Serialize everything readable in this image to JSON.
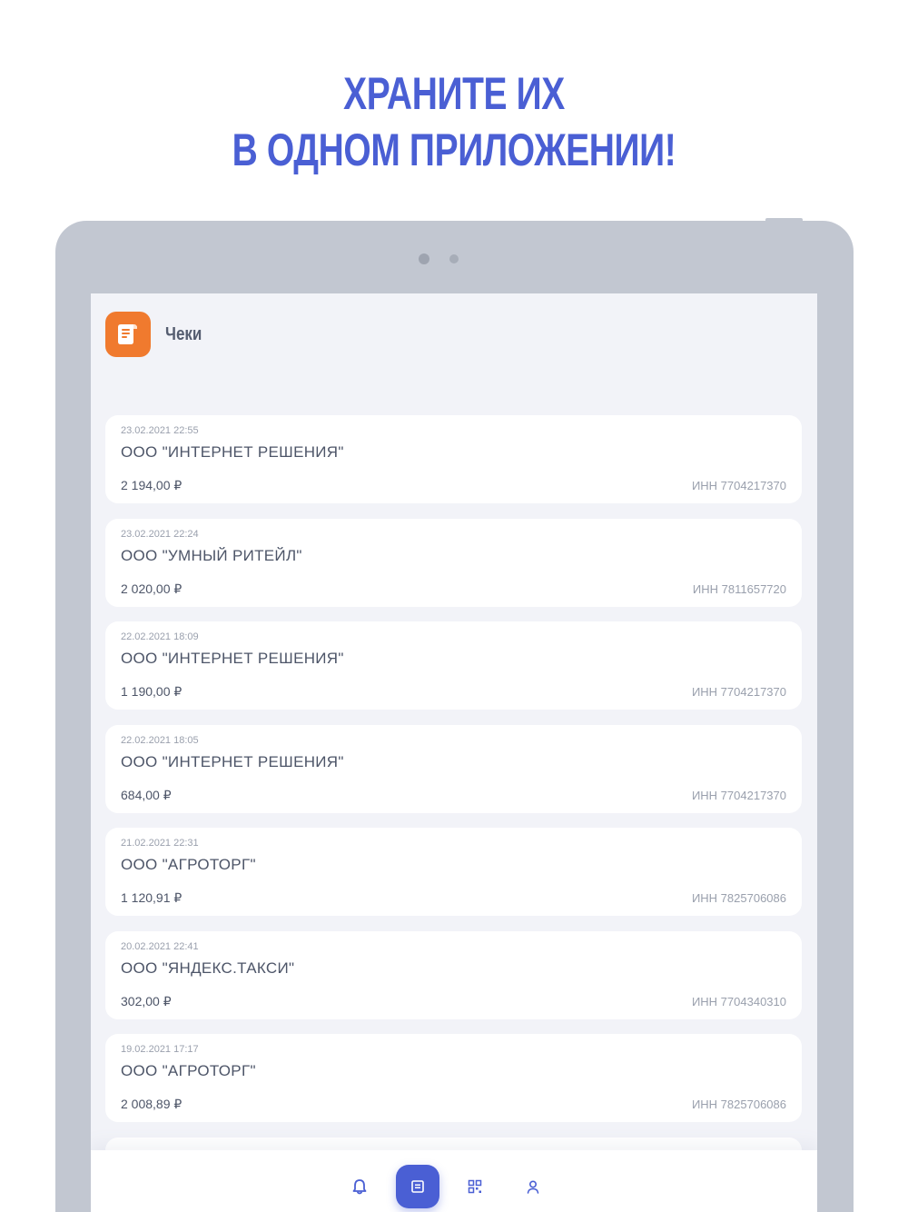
{
  "headline": {
    "line1": "ХРАНИТЕ ИХ",
    "line2": "В ОДНОМ ПРИЛОЖЕНИИ!"
  },
  "app": {
    "title": "Чеки",
    "icon": "receipt-scroll-icon"
  },
  "receipts": [
    {
      "date": "23.02.2021 22:55",
      "name": "ООО \"ИНТЕРНЕТ РЕШЕНИЯ\"",
      "amount": "2 194,00 ₽",
      "inn": "ИНН 7704217370"
    },
    {
      "date": "23.02.2021 22:24",
      "name": "ООО \"УМНЫЙ РИТЕЙЛ\"",
      "amount": "2 020,00 ₽",
      "inn": "ИНН 7811657720"
    },
    {
      "date": "22.02.2021 18:09",
      "name": "ООО \"ИНТЕРНЕТ РЕШЕНИЯ\"",
      "amount": "1 190,00 ₽",
      "inn": "ИНН 7704217370"
    },
    {
      "date": "22.02.2021 18:05",
      "name": "ООО \"ИНТЕРНЕТ РЕШЕНИЯ\"",
      "amount": "684,00 ₽",
      "inn": "ИНН 7704217370"
    },
    {
      "date": "21.02.2021 22:31",
      "name": "ООО \"АГРОТОРГ\"",
      "amount": "1 120,91 ₽",
      "inn": "ИНН 7825706086"
    },
    {
      "date": "20.02.2021 22:41",
      "name": "ООО \"ЯНДЕКС.ТАКСИ\"",
      "amount": "302,00 ₽",
      "inn": "ИНН 7704340310"
    },
    {
      "date": "19.02.2021 17:17",
      "name": "ООО \"АГРОТОРГ\"",
      "amount": "2 008,89 ₽",
      "inn": "ИНН 7825706086"
    }
  ],
  "tabbar": {
    "tabs": [
      {
        "icon": "bell-icon",
        "active": false
      },
      {
        "icon": "receipt-icon",
        "active": true
      },
      {
        "icon": "qr-code-icon",
        "active": false
      },
      {
        "icon": "user-icon",
        "active": false
      }
    ]
  },
  "colors": {
    "accent": "#4a5fd4",
    "app_icon": "#f07a2e",
    "device_frame": "#c2c7d1",
    "screen_bg": "#f2f3f8"
  }
}
